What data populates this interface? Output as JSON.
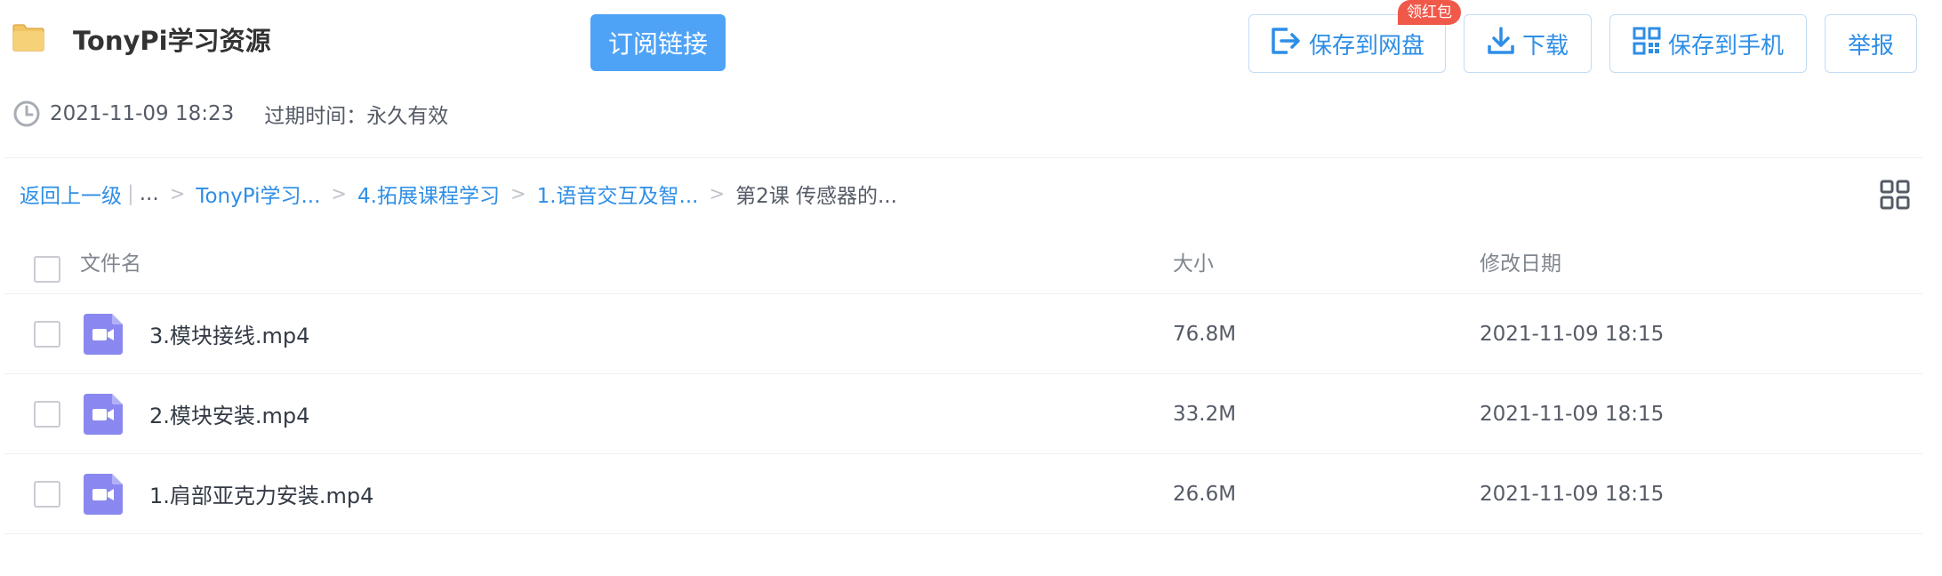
{
  "header": {
    "title": "TonyPi学习资源",
    "subscribe_label": "订阅链接",
    "red_badge": "领红包",
    "buttons": {
      "save_to_disk": "保存到网盘",
      "download": "下载",
      "save_to_phone": "保存到手机",
      "report": "举报"
    },
    "share_date": "2021-11-09 18:23",
    "expire_text": "过期时间：永久有效"
  },
  "breadcrumb": {
    "back": "返回上一级",
    "ellipsis": "...",
    "items": [
      "TonyPi学习...",
      "4.拓展课程学习",
      "1.语音交互及智..."
    ],
    "current": "第2课 传感器的..."
  },
  "table": {
    "columns": {
      "name": "文件名",
      "size": "大小",
      "date": "修改日期"
    },
    "rows": [
      {
        "name": "3.模块接线.mp4",
        "size": "76.8M",
        "date": "2021-11-09 18:15",
        "icon": "video-file-icon"
      },
      {
        "name": "2.模块安装.mp4",
        "size": "33.2M",
        "date": "2021-11-09 18:15",
        "icon": "video-file-icon"
      },
      {
        "name": "1.肩部亚克力安装.mp4",
        "size": "26.6M",
        "date": "2021-11-09 18:15",
        "icon": "video-file-icon"
      }
    ]
  },
  "colors": {
    "accent": "#2e8ee6",
    "subscribe_bg": "#4fa3f7",
    "badge_red": "#f0594a",
    "video_icon": "#8a88f0",
    "folder": "#f2c464"
  }
}
